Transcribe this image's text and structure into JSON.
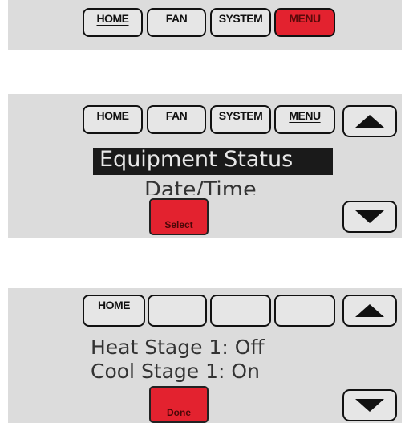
{
  "screen1": {
    "tabs": [
      "HOME",
      "FAN",
      "SYSTEM",
      "MENU"
    ]
  },
  "screen2": {
    "tabs": [
      "HOME",
      "FAN",
      "SYSTEM",
      "MENU"
    ],
    "menu_items": [
      "Equipment Status",
      "Date/Time"
    ],
    "select_label": "Select"
  },
  "screen3": {
    "tabs": [
      "HOME",
      "",
      "",
      ""
    ],
    "status_lines": [
      "Heat Stage 1: Off",
      "Cool Stage 1: On"
    ],
    "done_label": "Done"
  },
  "colors": {
    "panel": "#dcdcdc",
    "accent": "#e3222f",
    "highlight": "#1a1a1a"
  },
  "icons": [
    "up-arrow-icon",
    "down-arrow-icon"
  ]
}
